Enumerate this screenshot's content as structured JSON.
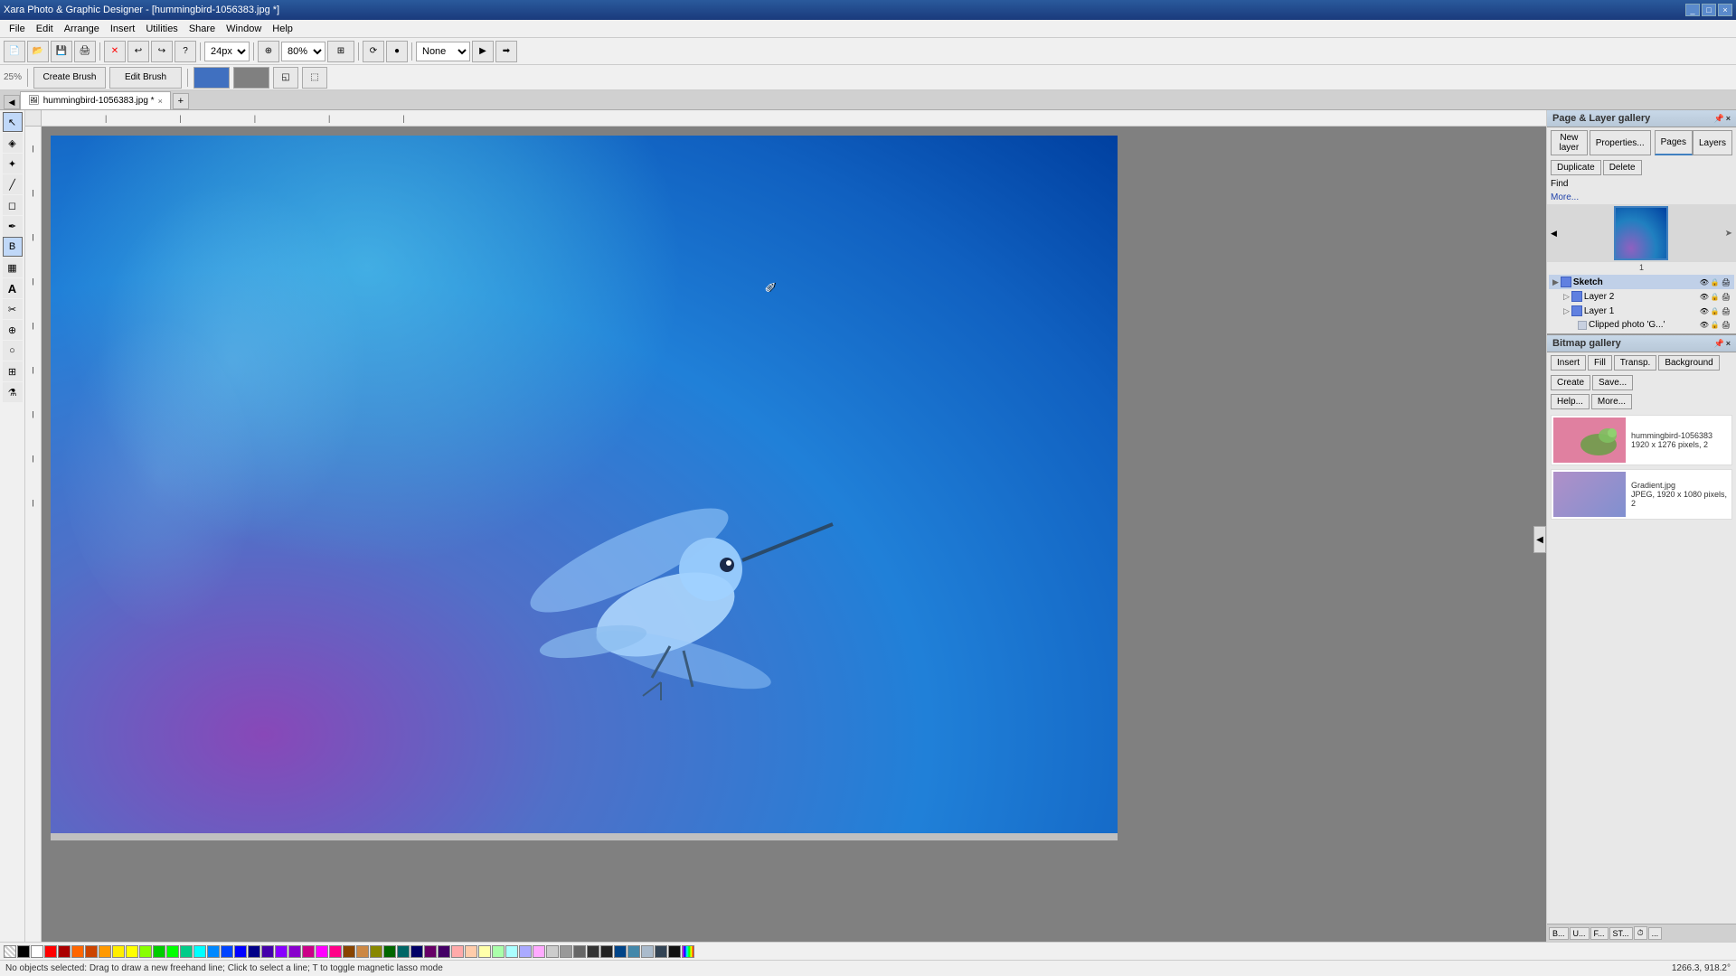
{
  "app": {
    "title": "Xara Photo & Graphic Designer - [hummingbird-1056383.jpg *]",
    "titlebar_controls": [
      "_",
      "□",
      "×"
    ]
  },
  "menu": {
    "items": [
      "File",
      "Edit",
      "Arrange",
      "Insert",
      "Utilities",
      "Share",
      "Window",
      "Help"
    ]
  },
  "toolbar1": {
    "zoom_value": "24px",
    "zoom_percent": "80%",
    "none_label": "None"
  },
  "toolbar2": {
    "zoom_display": "25%",
    "create_brush_label": "Create Brush",
    "edit_brush_label": "Edit Brush"
  },
  "tab": {
    "filename": "hummingbird-1056383.jpg *",
    "add_label": "+"
  },
  "toolbox": {
    "tools": [
      "↖",
      "▷",
      "◻",
      "⬡",
      "✏",
      "⟆",
      "B",
      "☵",
      "A",
      "✂",
      "⊕",
      "◎",
      "◱",
      "✦"
    ]
  },
  "layer_gallery": {
    "title": "Page & Layer gallery",
    "buttons": {
      "new_layer": "New layer",
      "properties": "Properties...",
      "pages_tab": "Pages",
      "duplicate": "Duplicate",
      "delete": "Delete",
      "layers_tab": "Layers",
      "find_placeholder": "Find",
      "more_label": "More..."
    },
    "page_number": "1",
    "layers": [
      {
        "name": "Sketch",
        "level": 0,
        "expanded": true,
        "bold": true
      },
      {
        "name": "Layer 2",
        "level": 1,
        "expanded": false
      },
      {
        "name": "Layer 1",
        "level": 1,
        "expanded": true
      },
      {
        "name": "Clipped photo 'G...'",
        "level": 2,
        "expanded": false
      }
    ]
  },
  "bitmap_gallery": {
    "title": "Bitmap gallery",
    "buttons": {
      "insert": "Insert",
      "fill": "Fill",
      "transp": "Transp.",
      "background": "Background",
      "create": "Create",
      "save": "Save...",
      "help": "Help...",
      "more": "More..."
    },
    "items": [
      {
        "name": "hummingbird-1056383",
        "details": "1920 x 1276 pixels, 2",
        "type": "hummingbird"
      },
      {
        "name": "Gradient.jpg",
        "details": "JPEG, 1920 x 1080 pixels, 2",
        "type": "gradient"
      }
    ]
  },
  "statusbar": {
    "message": "No objects selected: Drag to draw a new freehand line; Click to select a line; T to toggle magnetic lasso mode",
    "coordinates": "1266.3, 918.2°"
  },
  "right_panel_tabs": {
    "b_label": "B...",
    "u_label": "U...",
    "f_label": "F...",
    "st_label": "ST...",
    "clock_label": "⏱",
    "more_label": "..."
  },
  "colors": [
    "#ffffff",
    "#000000",
    "#ff0000",
    "#ff8800",
    "#ffff00",
    "#00ff00",
    "#00ffff",
    "#0000ff",
    "#8800ff",
    "#ff00ff",
    "#804000",
    "#c08000",
    "#808000",
    "#008000",
    "#008080",
    "#000080",
    "#800080",
    "#400080",
    "#ff8080",
    "#ffcc80",
    "#ffff80",
    "#80ff80",
    "#80ffff",
    "#8080ff",
    "#ff80ff",
    "#c0c0c0",
    "#808080",
    "#404040"
  ]
}
